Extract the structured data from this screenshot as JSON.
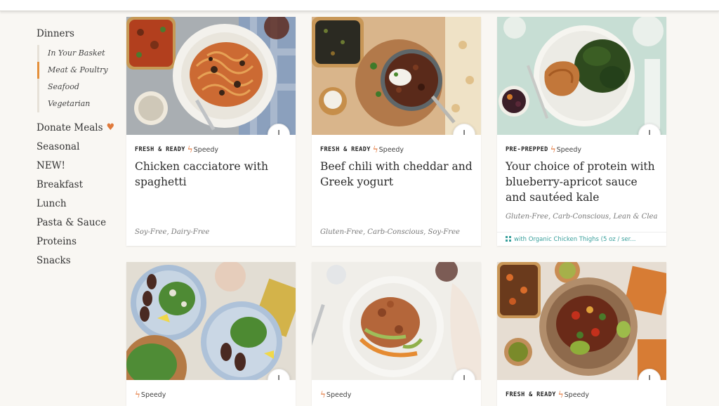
{
  "sidebar": {
    "dinners": "Dinners",
    "sub_items": [
      "In Your Basket",
      "Meat & Poultry",
      "Seafood",
      "Vegetarian"
    ],
    "donate": "Donate Meals",
    "heart": "♥",
    "items": [
      "Seasonal",
      "NEW!",
      "Breakfast",
      "Lunch",
      "Pasta & Sauce",
      "Proteins",
      "Snacks"
    ]
  },
  "bolt": "ϟ",
  "plus": "+",
  "cards": [
    {
      "badge": "FRESH & READY",
      "speed": "Speedy",
      "title": "Chicken cacciatore with spaghetti",
      "tags": "Soy-Free, Dairy-Free"
    },
    {
      "badge": "FRESH & READY",
      "speed": "Speedy",
      "title": "Beef chili with cheddar and Greek yogurt",
      "tags": "Gluten-Free, Carb-Conscious, Soy-Free"
    },
    {
      "badge": "PRE-PREPPED",
      "speed": "Speedy",
      "title": "Your choice of protein with blueberry-apricot sauce and sautéed kale",
      "tags": "Gluten-Free, Carb-Conscious, Lean & Clean,",
      "addon": "with Organic Chicken Thighs (5 oz / ser..."
    },
    {
      "badge": "",
      "speed": "Speedy"
    },
    {
      "badge": "",
      "speed": "Speedy"
    },
    {
      "badge": "FRESH & READY",
      "speed": "Speedy"
    }
  ]
}
